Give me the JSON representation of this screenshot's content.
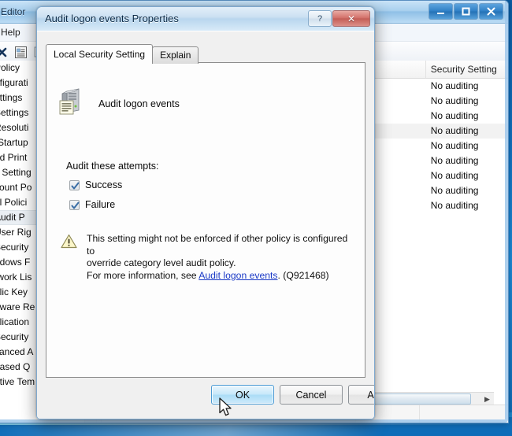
{
  "background_window": {
    "title": "Editor",
    "menu": [
      "Help"
    ],
    "window_controls": [
      {
        "name": "minimize",
        "glyph": "minimize-icon"
      },
      {
        "name": "maximize",
        "glyph": "maximize-icon"
      },
      {
        "name": "close",
        "glyph": "close-icon"
      }
    ],
    "toolbar_icons": [
      "delete-x-icon",
      "properties-icon",
      "help-icon"
    ],
    "tree_items": [
      "Policy",
      "nfigurati",
      "ettings",
      "Settings",
      "Resoluti",
      "(Startup",
      "ed Print",
      "y Setting",
      "count Po",
      "al Polici",
      "Audit P",
      "User Rig",
      "Security",
      "ndows F",
      "twork Lis",
      "blic Key",
      "ftware Re",
      "plication",
      "Security",
      "vanced A",
      "based Q",
      "ative Tem"
    ],
    "tree_selected_index": 10,
    "list_columns": [
      "Policy",
      "Security Setting"
    ],
    "list_rows": [
      {
        "policy": "",
        "setting": "No auditing"
      },
      {
        "policy": "",
        "setting": "No auditing"
      },
      {
        "policy": "",
        "setting": "No auditing"
      },
      {
        "policy": "",
        "setting": "No auditing"
      },
      {
        "policy": "",
        "setting": "No auditing"
      },
      {
        "policy": "",
        "setting": "No auditing"
      },
      {
        "policy": "",
        "setting": "No auditing"
      },
      {
        "policy": "",
        "setting": "No auditing"
      },
      {
        "policy": "",
        "setting": "No auditing"
      }
    ],
    "list_selected_index": 3,
    "hscroll_arrow": "▶"
  },
  "dialog": {
    "title": "Audit logon events Properties",
    "help_button_label": "?",
    "close_button_label": "✕",
    "tabs": [
      {
        "label": "Local Security Setting",
        "active": true
      },
      {
        "label": "Explain",
        "active": false
      }
    ],
    "policy_icon": "computer-policy-icon",
    "policy_name": "Audit logon events",
    "section_label": "Audit these attempts:",
    "checkboxes": [
      {
        "label": "Success",
        "checked": true
      },
      {
        "label": "Failure",
        "checked": true
      }
    ],
    "warning": {
      "icon": "warning-triangle-icon",
      "line1": "This setting might not be enforced if other policy is configured to",
      "line2": "override category level audit policy.",
      "line3_prefix": "For more information, see ",
      "link_text": "Audit logon events",
      "line3_suffix": ". (Q921468)"
    },
    "buttons": [
      {
        "name": "ok",
        "label": "OK",
        "state": "hover-default"
      },
      {
        "name": "cancel",
        "label": "Cancel",
        "state": "normal"
      },
      {
        "name": "apply",
        "label": "Apply",
        "state": "normal"
      }
    ]
  },
  "colors": {
    "accent_blue": "#2f80c6",
    "link_blue": "#1a39c6",
    "close_red": "#c45e57",
    "ok_highlight": "#aadcf6",
    "desktop_blue": "#1277c8"
  }
}
